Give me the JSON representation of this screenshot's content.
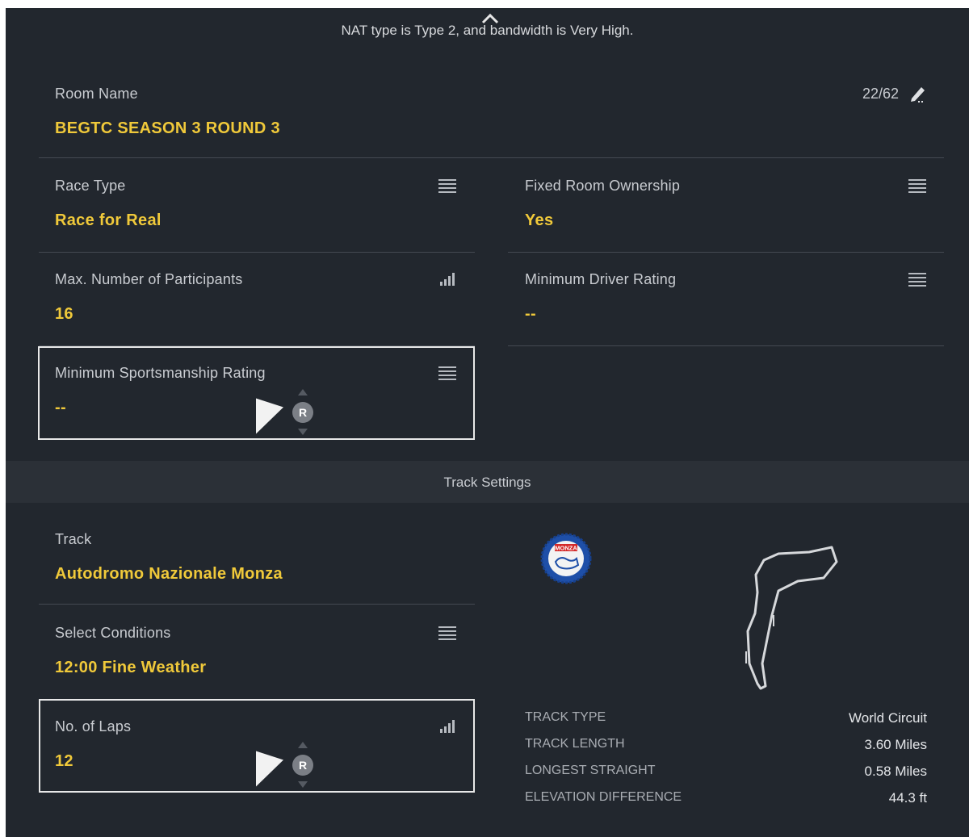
{
  "status_text": "NAT type is Type 2, and bandwidth is Very High.",
  "room_name": {
    "label": "Room Name",
    "value": "BEGTC SEASON 3 ROUND 3",
    "char_count": "22/62",
    "edit_icon": "pencil-icon"
  },
  "race_type": {
    "label": "Race Type",
    "value": "Race for Real",
    "icon": "menu-icon"
  },
  "fixed_room_ownership": {
    "label": "Fixed Room Ownership",
    "value": "Yes",
    "icon": "menu-icon"
  },
  "max_participants": {
    "label": "Max. Number of Participants",
    "value": "16",
    "icon": "signal-bars-icon"
  },
  "min_driver_rating": {
    "label": "Minimum Driver Rating",
    "value": "--",
    "icon": "menu-icon"
  },
  "min_sportsmanship_rating": {
    "label": "Minimum Sportsmanship Rating",
    "value": "--",
    "icon": "menu-icon"
  },
  "controller_button": "R",
  "track_settings_header": "Track Settings",
  "track": {
    "label": "Track",
    "value": "Autodromo Nazionale Monza",
    "logo_text": "MONZA"
  },
  "conditions": {
    "label": "Select Conditions",
    "value": "12:00 Fine Weather",
    "icon": "menu-icon"
  },
  "laps": {
    "label": "No. of Laps",
    "value": "12",
    "icon": "signal-bars-icon"
  },
  "track_info": [
    {
      "label": "TRACK TYPE",
      "value": "World Circuit"
    },
    {
      "label": "TRACK LENGTH",
      "value": "3.60 Miles"
    },
    {
      "label": "LONGEST STRAIGHT",
      "value": "0.58 Miles"
    },
    {
      "label": "ELEVATION DIFFERENCE",
      "value": "44.3 ft"
    }
  ],
  "colors": {
    "background": "#22272e",
    "band": "#2b3037",
    "accent_yellow": "#f0c93a",
    "label_grey": "#c9ccd1"
  }
}
